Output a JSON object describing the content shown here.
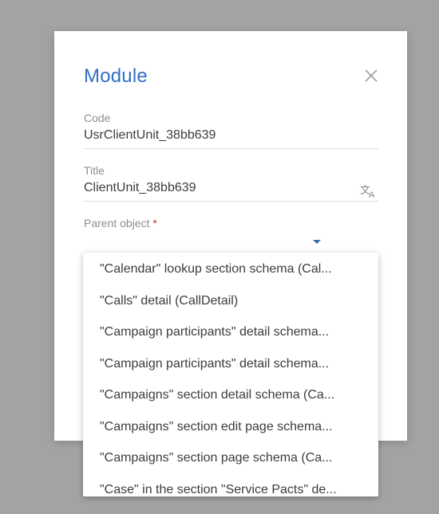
{
  "dialog": {
    "title": "Module",
    "fields": {
      "code": {
        "label": "Code",
        "value": "UsrClientUnit_38bb639"
      },
      "title": {
        "label": "Title",
        "value": "ClientUnit_38bb639"
      },
      "parent_object": {
        "label": "Parent object",
        "required_mark": "*",
        "value": ""
      }
    }
  },
  "dropdown": {
    "items": [
      "\"Calendar\" lookup section schema (Cal...",
      "\"Calls\" detail (CallDetail)",
      "\"Campaign participants\" detail schema...",
      "\"Campaign participants\" detail schema...",
      "\"Campaigns\" section detail schema (Ca...",
      "\"Campaigns\" section edit page schema...",
      "\"Campaigns\" section page schema (Ca...",
      "\"Case\" in the section \"Service Pacts\" de..."
    ]
  },
  "colors": {
    "overlay": "#a3a3a3",
    "title": "#2f6fc6",
    "required": "#d32f2f",
    "caret": "#3d68a8"
  },
  "icons": {
    "close": "close-icon",
    "translate": "translate-icon",
    "caret": "chevron-down-icon"
  }
}
